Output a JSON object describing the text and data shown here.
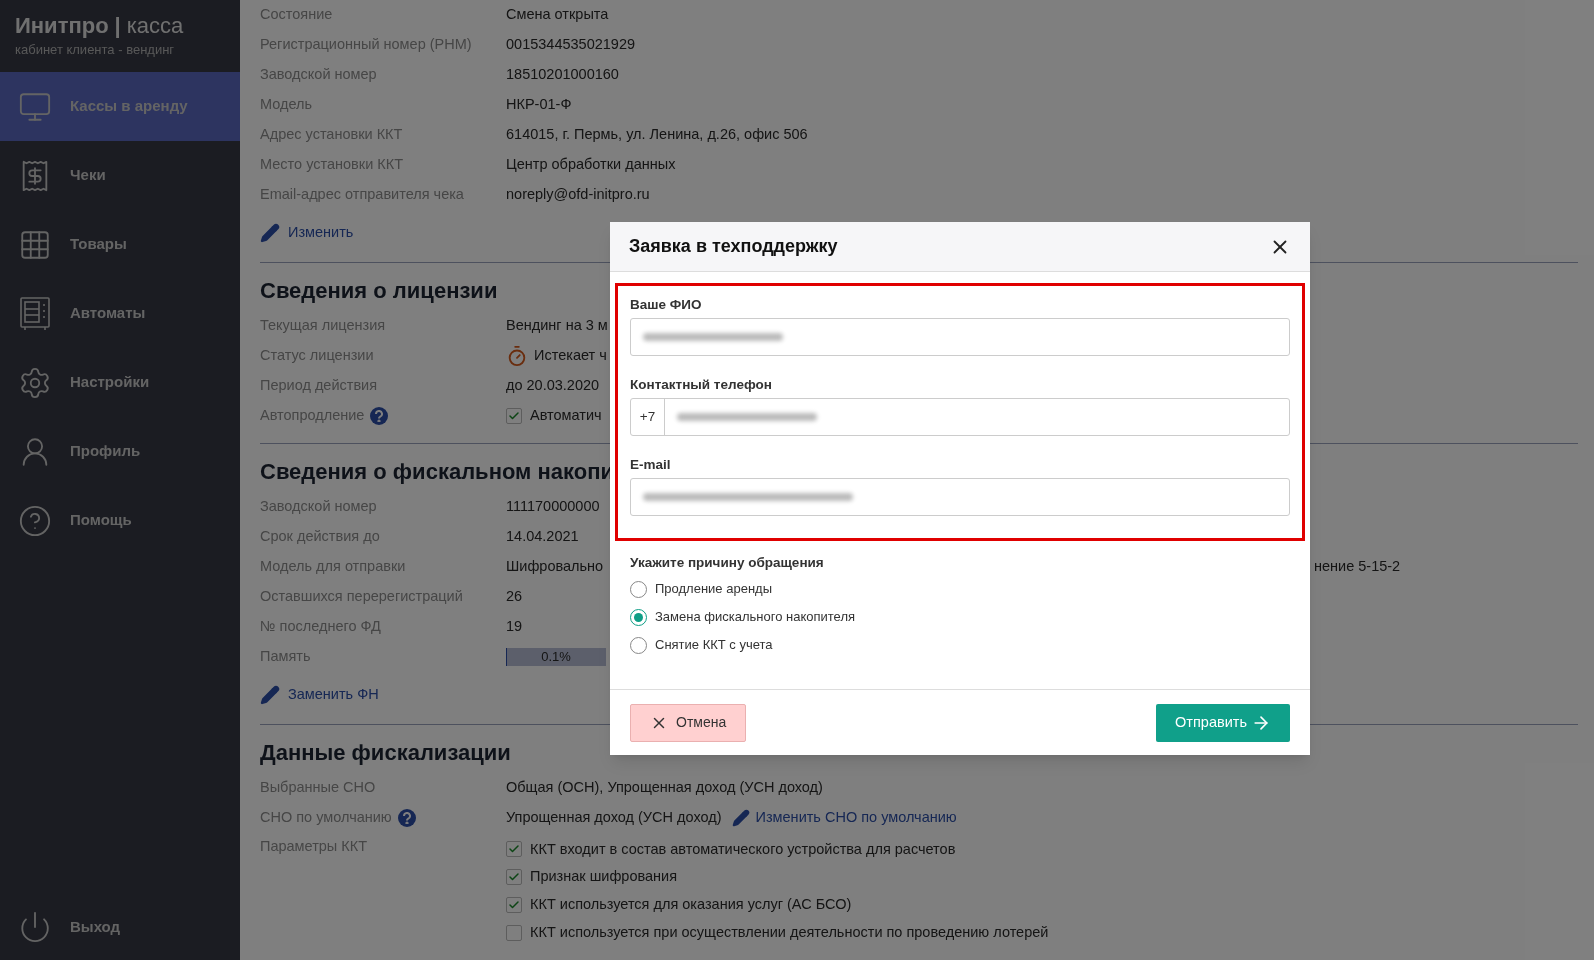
{
  "sidebar": {
    "logo": {
      "brand": "Инитпро",
      "separator": "|",
      "product": "касса"
    },
    "subtitle": "кабинет клиента - вендинг",
    "items": [
      {
        "label": "Кассы в аренду",
        "selected": true
      },
      {
        "label": "Чеки",
        "selected": false
      },
      {
        "label": "Товары",
        "selected": false
      },
      {
        "label": "Автоматы",
        "selected": false
      },
      {
        "label": "Настройки",
        "selected": false
      },
      {
        "label": "Профиль",
        "selected": false
      },
      {
        "label": "Помощь",
        "selected": false
      }
    ],
    "logout": {
      "label": "Выход"
    }
  },
  "sections": [
    {
      "rows": [
        {
          "kind": "text",
          "label": "Состояние",
          "value": "Смена открыта"
        },
        {
          "kind": "text",
          "label": "Регистрационный номер (РНМ)",
          "value": "0015344535021929"
        },
        {
          "kind": "text",
          "label": "Заводской номер",
          "value": "18510201000160"
        },
        {
          "kind": "text",
          "label": "Модель",
          "value": "НКР-01-Ф"
        },
        {
          "kind": "text",
          "label": "Адрес установки ККТ",
          "value": "614015, г. Пермь, ул. Ленина, д.26, офис 506"
        },
        {
          "kind": "text",
          "label": "Место установки ККТ",
          "value": "Центр обработки данных"
        },
        {
          "kind": "text",
          "label": "Email-адрес отправителя чека",
          "value": "noreply@ofd-initpro.ru"
        }
      ],
      "link": "Изменить"
    },
    {
      "heading": "Сведения о лицензии",
      "rows": [
        {
          "kind": "text",
          "label": "Текущая лицензия",
          "value": "Вендинг на 3 м"
        },
        {
          "kind": "status",
          "label": "Статус лицензии",
          "value": "Истекает ч"
        },
        {
          "kind": "text",
          "label": "Период действия",
          "value": "до 20.03.2020"
        },
        {
          "kind": "checkbox",
          "label": "Автопродление",
          "help": true,
          "checked": true,
          "value": "Автоматич"
        }
      ]
    },
    {
      "heading": "Сведения о фискальном накопи",
      "rows": [
        {
          "kind": "text",
          "label": "Заводской номер",
          "value": "111170000000"
        },
        {
          "kind": "text",
          "label": "Срок действия до",
          "value": "14.04.2021"
        },
        {
          "kind": "split",
          "label": "Модель для отправки",
          "value": "Шифровально",
          "value_end": "нение 5-15-2"
        },
        {
          "kind": "text",
          "label": "Оставшихся перерегистраций",
          "value": "26"
        },
        {
          "kind": "text",
          "label": "№ последнего ФД",
          "value": "19"
        },
        {
          "kind": "progress",
          "label": "Память",
          "level": 0.001,
          "reading": "0.1%"
        }
      ],
      "link": "Заменить ФН"
    },
    {
      "heading": "Данные фискализации",
      "rows": [
        {
          "kind": "text",
          "label": "Выбранные СНО",
          "value": "Общая (ОСН), Упрощенная доход (УСН доход)"
        },
        {
          "kind": "text_link",
          "label": "СНО по умолчанию",
          "help": true,
          "value": "Упрощенная доход (УСН доход)",
          "link": "Изменить СНО по умолчанию"
        },
        {
          "kind": "checklist",
          "label": "Параметры ККТ",
          "items": [
            {
              "label": "ККТ входит в состав автоматического устройства для расчетов",
              "checked": true
            },
            {
              "label": "Признак шифрования",
              "checked": true
            },
            {
              "label": "ККТ используется для оказания услуг (АС БСО)",
              "checked": true
            },
            {
              "label": "ККТ используется при осуществлении деятельности по проведению лотерей",
              "checked": false
            }
          ]
        }
      ]
    }
  ],
  "modal": {
    "title": "Заявка в техподдержку",
    "highlighted": true,
    "fields": [
      {
        "kind": "text",
        "label": "Ваше ФИО",
        "redacted": true
      },
      {
        "kind": "phone",
        "label": "Контактный телефон",
        "prefix": "+7",
        "redacted": true
      },
      {
        "kind": "text",
        "label": "E-mail",
        "redacted": true
      }
    ],
    "reason": {
      "label": "Укажите причину обращения",
      "options": [
        {
          "label": "Продление аренды",
          "selected": false
        },
        {
          "label": "Замена фискального накопителя",
          "selected": true
        },
        {
          "label": "Снятие ККТ с учета",
          "selected": false
        }
      ]
    },
    "cancel": "Отмена",
    "submit": "Отправить"
  }
}
